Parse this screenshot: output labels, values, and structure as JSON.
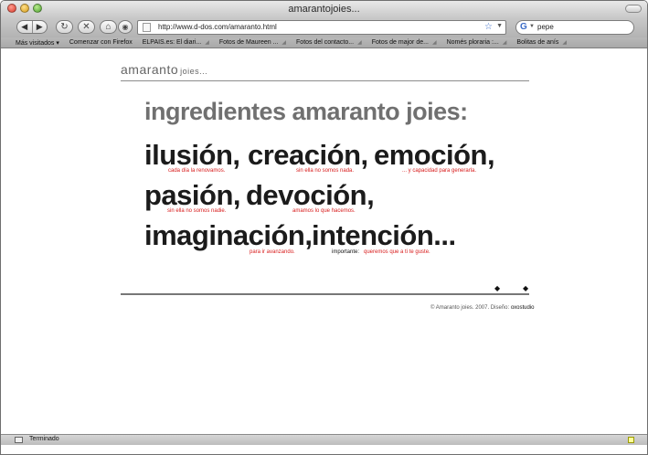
{
  "window": {
    "title": "amarantojoies..."
  },
  "toolbar": {
    "back_icon": "◀",
    "forward_icon": "▶",
    "reload_icon": "↻",
    "stop_icon": "✕",
    "home_icon": "⌂",
    "url": "http://www.d-dos.com/amaranto.html",
    "search_value": "pepe",
    "search_engine": "G"
  },
  "bookmarks": [
    {
      "label": "Más visitados ▾"
    },
    {
      "label": "Comenzar con Firefox"
    },
    {
      "label": "ELPAIS.es: El diari..."
    },
    {
      "label": "Fotos de Maureen ..."
    },
    {
      "label": "Fotos del contacto..."
    },
    {
      "label": "Fotos de major de..."
    },
    {
      "label": "Només ploraria :..."
    },
    {
      "label": "Bolitas de anís"
    }
  ],
  "logo": {
    "main": "amaranto",
    "sub": "joies..."
  },
  "heading": "ingredientes amaranto joies:",
  "words": {
    "ilusion": "ilusión,",
    "creacion": "creación,",
    "emocion": "emoción,",
    "pasion": "pasión,",
    "devocion": "devoción,",
    "imaginacion": "imaginación,",
    "intencion": "intención..."
  },
  "notes": {
    "ilusion": "cada día la renovamos.",
    "creacion": "sin ella no somos nada.",
    "emocion": "... y capacidad para generarla.",
    "pasion": "sin ella no somos nadie.",
    "devocion": "amamos lo que hacemos.",
    "imaginacion": "para ir avanzando.",
    "intencion_label": "importante:",
    "intencion": "queremos que a ti te guste."
  },
  "nav": {
    "prev": "◆",
    "next": "◆"
  },
  "footer": {
    "text": "© Amaranto joies. 2007. Diseño:",
    "studio": "oxostudio"
  },
  "status": {
    "text": "Terminado"
  },
  "colors": {
    "accent_red": "#d81c1c",
    "heading_gray": "#707070"
  }
}
